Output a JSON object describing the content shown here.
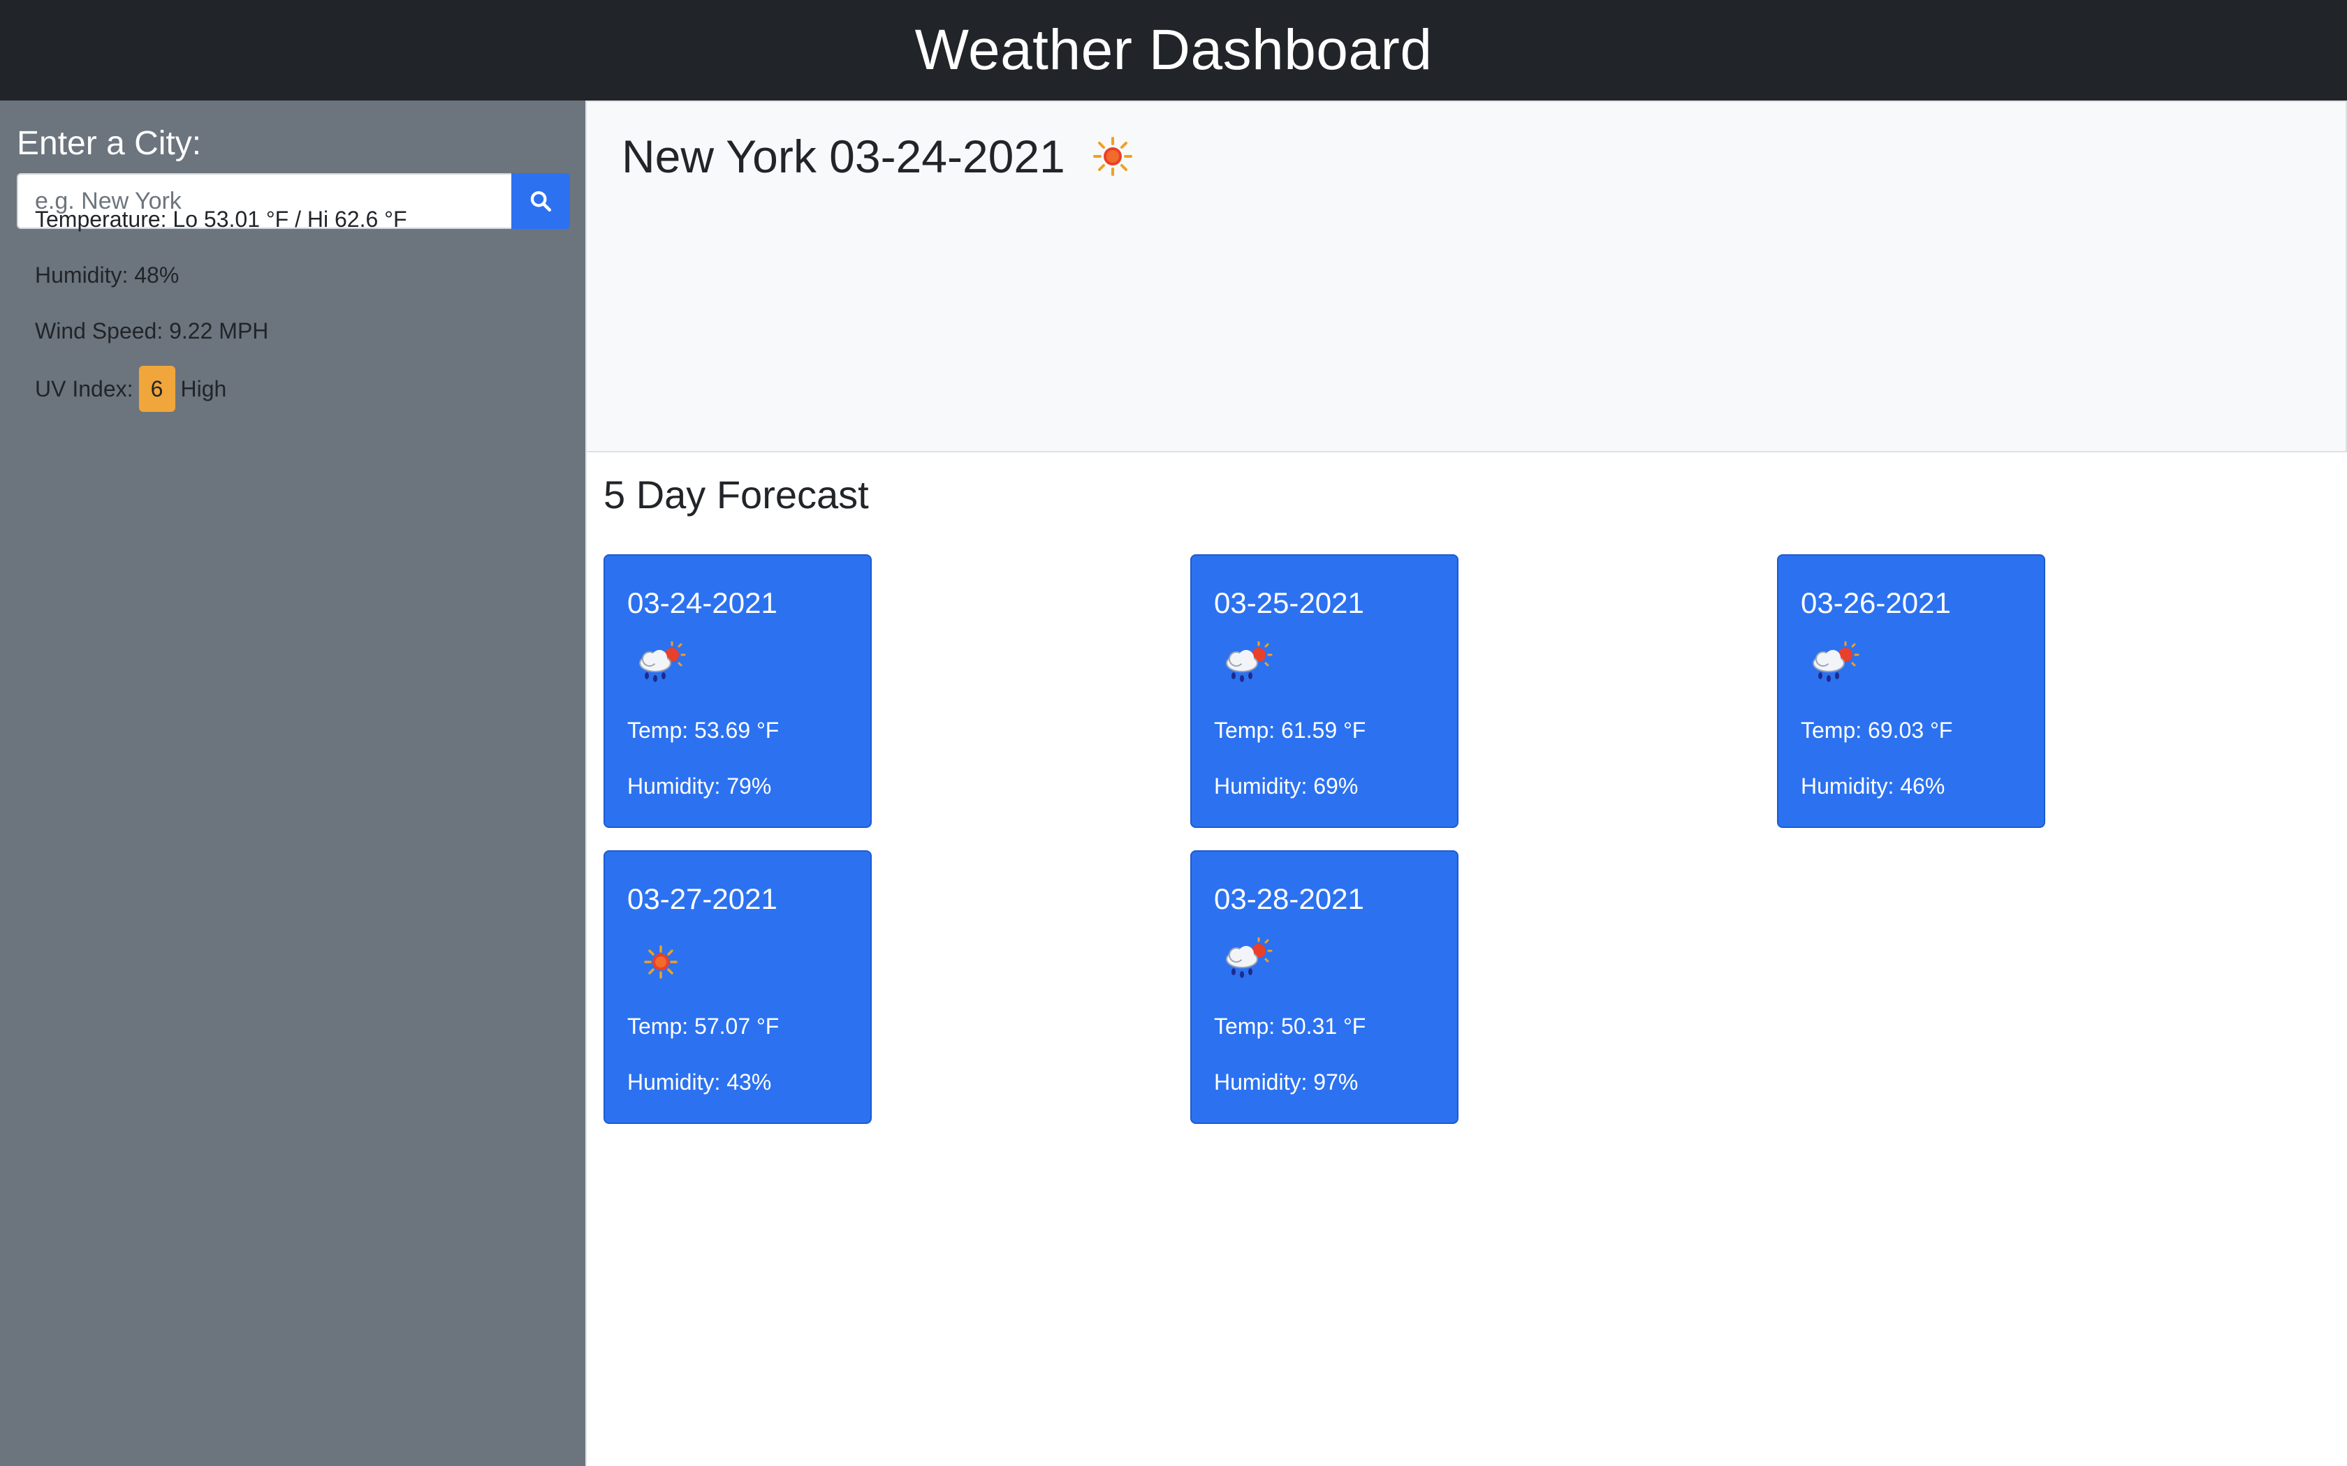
{
  "header": {
    "title": "Weather Dashboard"
  },
  "sidebar": {
    "label": "Enter a City:",
    "search_placeholder": "e.g. New York",
    "search_value": "",
    "search_button_icon": "search-icon"
  },
  "current": {
    "title": "New York 03-24-2021",
    "icon": "sun-icon",
    "temperature_label": "Temperature:",
    "temperature_value": "Lo 53.01 °F / Hi 62.6 °F",
    "humidity_label": "Humidity:",
    "humidity_value": "48%",
    "wind_label": "Wind Speed:",
    "wind_value": "9.22 MPH",
    "uv_label": "UV Index:",
    "uv_value": "6",
    "uv_text": "High",
    "uv_color": "#f0a63a"
  },
  "forecast": {
    "title": "5 Day Forecast",
    "card_color": "#2c72f0",
    "days": [
      {
        "date": "03-24-2021",
        "icon": "rain-sun-icon",
        "temp": "Temp: 53.69 °F",
        "humidity": "Humidity: 79%"
      },
      {
        "date": "03-25-2021",
        "icon": "rain-sun-icon",
        "temp": "Temp: 61.59 °F",
        "humidity": "Humidity: 69%"
      },
      {
        "date": "03-26-2021",
        "icon": "rain-sun-icon",
        "temp": "Temp: 69.03 °F",
        "humidity": "Humidity: 46%"
      },
      {
        "date": "03-27-2021",
        "icon": "sun-icon",
        "temp": "Temp: 57.07 °F",
        "humidity": "Humidity: 43%"
      },
      {
        "date": "03-28-2021",
        "icon": "rain-sun-icon",
        "temp": "Temp: 50.31 °F",
        "humidity": "Humidity: 97%"
      }
    ]
  }
}
